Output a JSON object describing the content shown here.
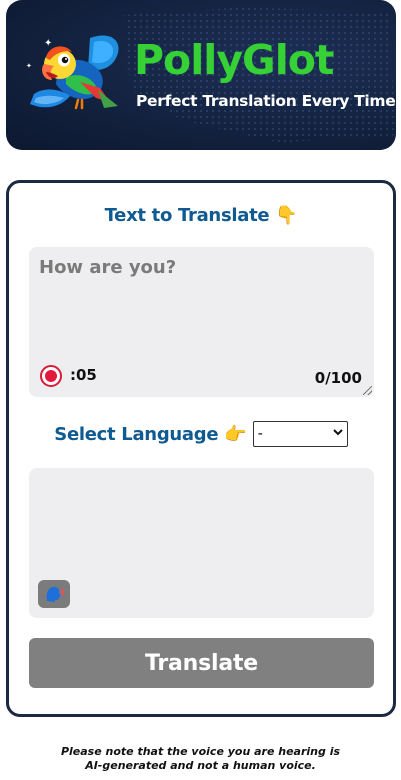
{
  "header": {
    "brand_name": "PollyGlot",
    "tagline": "Perfect Translation Every Time"
  },
  "input_section": {
    "title": "Text to Translate",
    "title_emoji": "👇",
    "placeholder": "How are you?",
    "value": "",
    "timer": ":05",
    "char_count": "0/100"
  },
  "language_section": {
    "label": "Select Language",
    "label_emoji": "👉",
    "selected": "-",
    "options": [
      "-"
    ]
  },
  "output_section": {
    "text": ""
  },
  "translate_button": {
    "label": "Translate"
  },
  "disclaimer": {
    "line1": "Please note that the voice you are hearing is",
    "line2": "AI-generated and not a human voice."
  },
  "colors": {
    "brand_green": "#35d135",
    "title_blue": "#0f5a91",
    "header_bg": "#13223f",
    "card_border": "#1b2a40",
    "field_bg": "#eeeef0",
    "button_gray": "#808080",
    "record_red": "#e3183a"
  },
  "icons": {
    "logo": "parrot-logo",
    "record": "record-icon",
    "speak": "speaking-head-icon"
  }
}
